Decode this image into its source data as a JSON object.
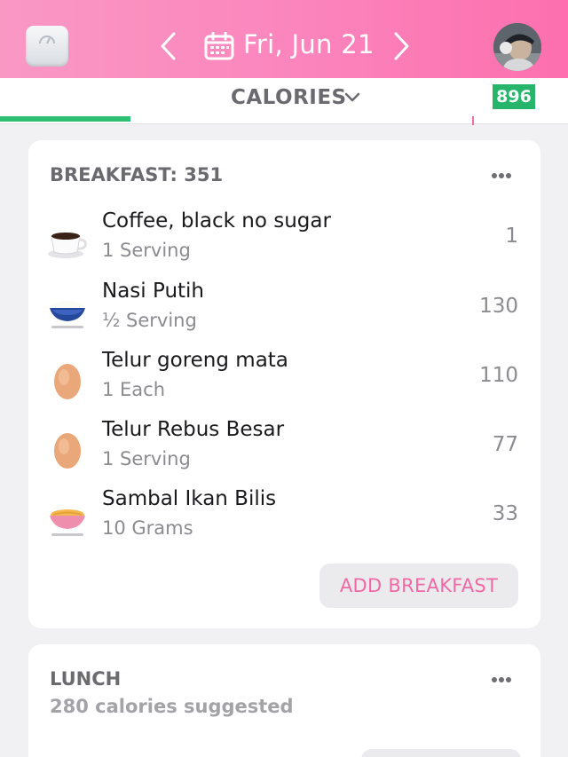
{
  "header": {
    "date": "Fri, Jun 21",
    "icons": {
      "scale": "scale-icon",
      "prev": "chevron-left-icon",
      "next": "chevron-right-icon",
      "calendar": "calendar-icon",
      "avatar": "user-avatar"
    }
  },
  "tracker": {
    "metric_label": "CALORIES",
    "remaining": "896",
    "progress_fraction": 0.23,
    "colors": {
      "progress": "#2ebf73",
      "badge": "#26b56a",
      "accent": "#ef6aa5"
    }
  },
  "breakfast": {
    "title": "BREAKFAST: 351",
    "items": [
      {
        "name": "Coffee, black no sugar",
        "serving": "1 Serving",
        "calories": "1",
        "icon": "coffee-cup-icon"
      },
      {
        "name": "Nasi Putih",
        "serving": "½ Serving",
        "calories": "130",
        "icon": "rice-bowl-icon"
      },
      {
        "name": "Telur goreng mata",
        "serving": "1 Each",
        "calories": "110",
        "icon": "egg-icon"
      },
      {
        "name": "Telur Rebus Besar",
        "serving": "1 Serving",
        "calories": "77",
        "icon": "egg-icon"
      },
      {
        "name": "Sambal Ikan Bilis",
        "serving": "10 Grams",
        "calories": "33",
        "icon": "soup-bowl-icon"
      }
    ],
    "add_label": "ADD BREAKFAST"
  },
  "lunch": {
    "title": "LUNCH",
    "subtitle": "280 calories suggested"
  }
}
